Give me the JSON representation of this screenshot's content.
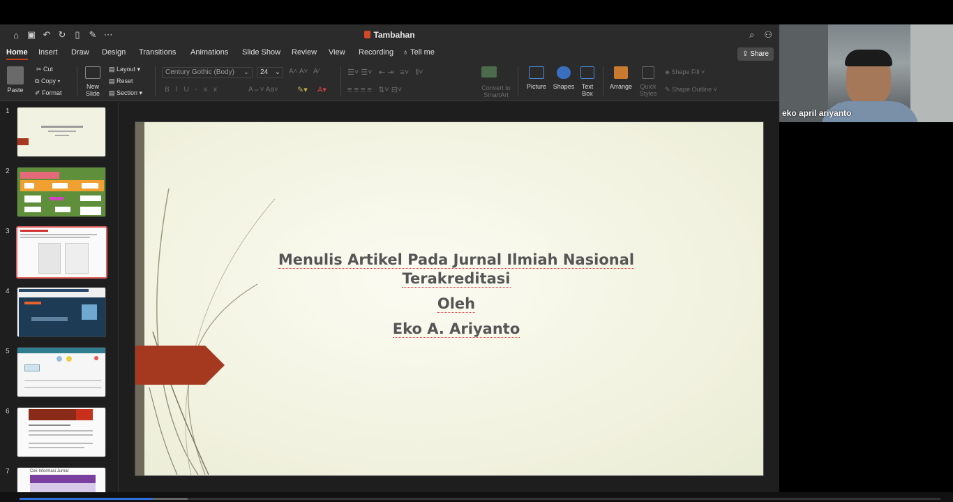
{
  "app": {
    "title": "Tambahan",
    "share_label": "Share"
  },
  "tabs": [
    "Home",
    "Insert",
    "Draw",
    "Design",
    "Transitions",
    "Animations",
    "Slide Show",
    "Review",
    "View",
    "Recording",
    "Tell me"
  ],
  "ribbon": {
    "paste": "Paste",
    "cut": "Cut",
    "copy": "Copy",
    "format": "Format",
    "new_slide_1": "New",
    "new_slide_2": "Slide",
    "layout": "Layout",
    "reset": "Reset",
    "section": "Section",
    "font_name": "Century Gothic (Body)",
    "font_size": "24",
    "convert_1": "Convert to",
    "convert_2": "SmartArt",
    "picture": "Picture",
    "shapes": "Shapes",
    "textbox_1": "Text",
    "textbox_2": "Box",
    "arrange": "Arrange",
    "quick_1": "Quick",
    "quick_2": "Styles",
    "shape_fill": "Shape Fill",
    "shape_outline": "Shape Outline"
  },
  "thumbnails": {
    "numbers": [
      "1",
      "2",
      "3",
      "4",
      "5",
      "6",
      "7"
    ],
    "selected": 3,
    "slide7_label": "Cek Informasi Jurnal"
  },
  "slide": {
    "title_line1": "Menulis Artikel Pada Jurnal Ilmiah Nasional",
    "title_line2": "Terakreditasi",
    "oleh": "Oleh",
    "author": "Eko A. Ariyanto"
  },
  "video": {
    "participant": "eko april ariyanto"
  },
  "playback": {
    "progress_fraction": 0.145
  }
}
